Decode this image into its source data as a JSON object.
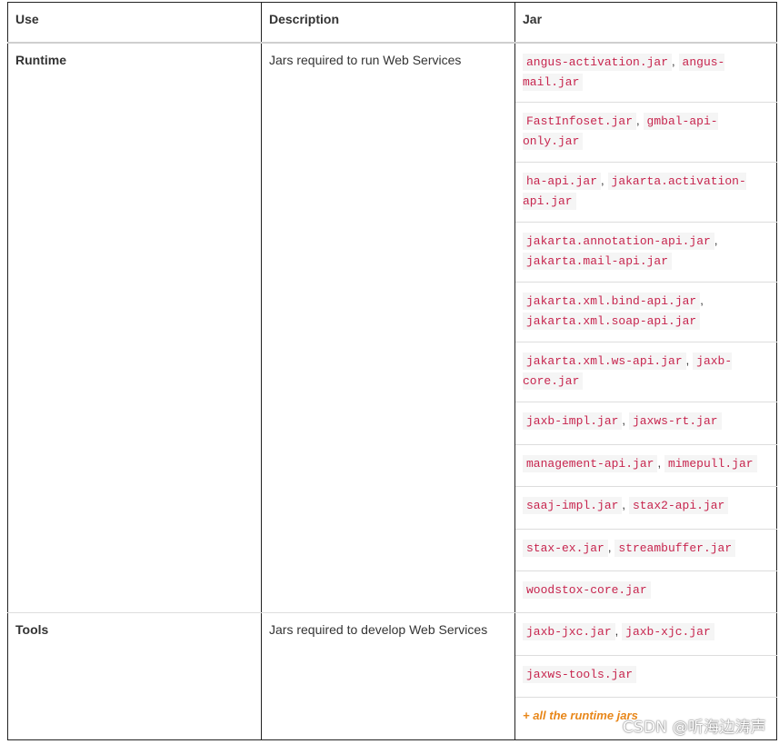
{
  "table": {
    "headers": [
      "Use",
      "Description",
      "Jar"
    ],
    "groups": [
      {
        "use": "Runtime",
        "description": "Jars required to run Web Services",
        "jar_rows": [
          [
            "angus-activation.jar",
            "angus-mail.jar"
          ],
          [
            "FastInfoset.jar",
            "gmbal-api-only.jar"
          ],
          [
            "ha-api.jar",
            "jakarta.activation-api.jar"
          ],
          [
            "jakarta.annotation-api.jar",
            "jakarta.mail-api.jar"
          ],
          [
            "jakarta.xml.bind-api.jar",
            "jakarta.xml.soap-api.jar"
          ],
          [
            "jakarta.xml.ws-api.jar",
            "jaxb-core.jar"
          ],
          [
            "jaxb-impl.jar",
            "jaxws-rt.jar"
          ],
          [
            "management-api.jar",
            "mimepull.jar"
          ],
          [
            "saaj-impl.jar",
            "stax2-api.jar"
          ],
          [
            "stax-ex.jar",
            "streambuffer.jar"
          ],
          [
            "woodstox-core.jar"
          ]
        ]
      },
      {
        "use": "Tools",
        "description": "Jars required to develop Web Services",
        "jar_rows": [
          [
            "jaxb-jxc.jar",
            "jaxb-xjc.jar"
          ],
          [
            "jaxws-tools.jar"
          ]
        ],
        "note": "+ all the runtime jars"
      }
    ],
    "separator": ","
  },
  "watermark": "CSDN @听海边涛声"
}
